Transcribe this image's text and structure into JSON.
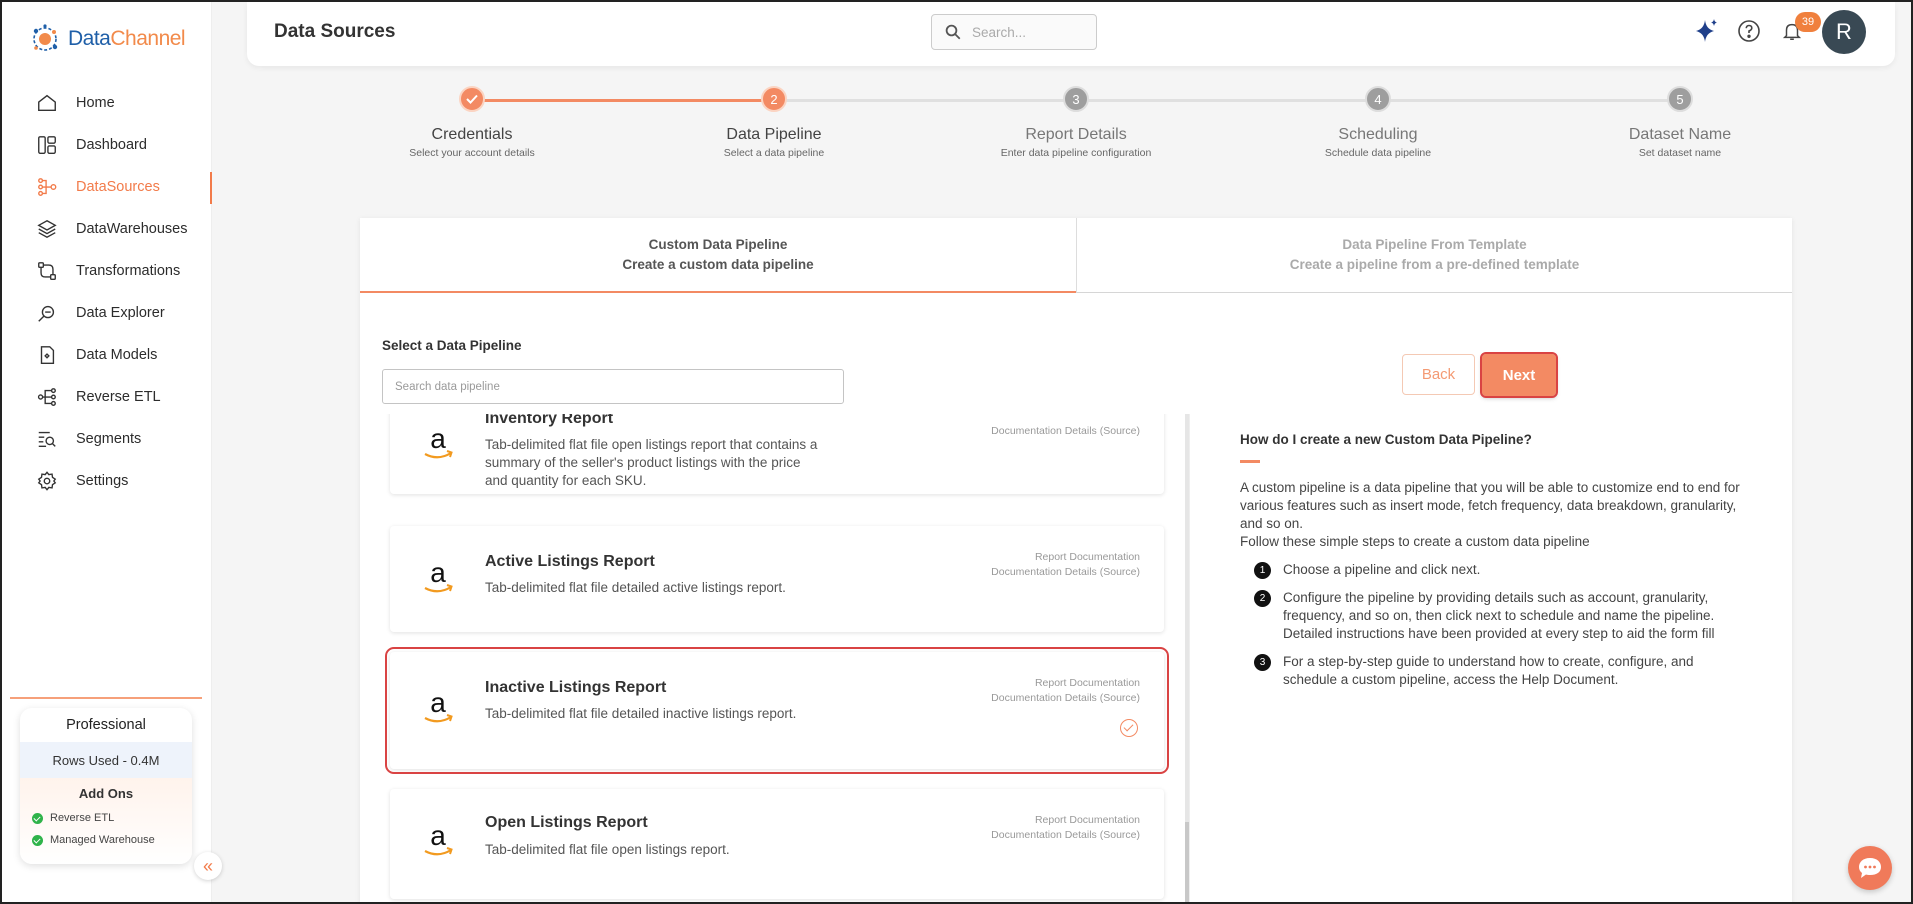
{
  "brand": {
    "name_part1": "Data",
    "name_part2": "Channel"
  },
  "sidebar": {
    "items": [
      {
        "label": "Home",
        "icon": "home-icon"
      },
      {
        "label": "Dashboard",
        "icon": "dashboard-icon"
      },
      {
        "label": "DataSources",
        "icon": "datasources-icon",
        "active": true
      },
      {
        "label": "DataWarehouses",
        "icon": "layers-icon"
      },
      {
        "label": "Transformations",
        "icon": "transform-icon"
      },
      {
        "label": "Data Explorer",
        "icon": "explorer-icon"
      },
      {
        "label": "Data Models",
        "icon": "model-icon"
      },
      {
        "label": "Reverse ETL",
        "icon": "reverse-etl-icon"
      },
      {
        "label": "Segments",
        "icon": "segments-icon"
      },
      {
        "label": "Settings",
        "icon": "gear-icon"
      }
    ],
    "plan": {
      "name": "Professional",
      "rows_used": "Rows Used - 0.4M",
      "addons_title": "Add Ons",
      "addons": [
        "Reverse ETL",
        "Managed Warehouse"
      ]
    }
  },
  "header": {
    "title": "Data Sources",
    "search_placeholder": "Search...",
    "notification_count": "39",
    "avatar_initial": "R"
  },
  "stepper": {
    "steps": [
      {
        "number": "",
        "name": "Credentials",
        "subtitle": "Select your account details",
        "state": "done"
      },
      {
        "number": "2",
        "name": "Data Pipeline",
        "subtitle": "Select a data pipeline",
        "state": "current"
      },
      {
        "number": "3",
        "name": "Report Details",
        "subtitle": "Enter data pipeline configuration",
        "state": "todo"
      },
      {
        "number": "4",
        "name": "Scheduling",
        "subtitle": "Schedule data pipeline",
        "state": "todo"
      },
      {
        "number": "5",
        "name": "Dataset Name",
        "subtitle": "Set dataset name",
        "state": "todo"
      }
    ]
  },
  "tabs": {
    "custom": {
      "title": "Custom Data Pipeline",
      "subtitle": "Create a custom data pipeline"
    },
    "template": {
      "title": "Data Pipeline From Template",
      "subtitle": "Create a pipeline from a pre-defined template"
    }
  },
  "pipeline": {
    "select_label": "Select a Data Pipeline",
    "search_placeholder": "Search data pipeline",
    "back_label": "Back",
    "next_label": "Next",
    "items": [
      {
        "title": "Inventory Report",
        "desc": "Tab-delimited flat file open listings report that contains a summary of the seller's product listings with the price and quantity for each SKU.",
        "link1": "",
        "link2": "Documentation Details (Source)"
      },
      {
        "title": "Active Listings Report",
        "desc": "Tab-delimited flat file detailed active listings report.",
        "link1": "Report Documentation",
        "link2": "Documentation Details (Source)"
      },
      {
        "title": "Inactive Listings Report",
        "desc": "Tab-delimited flat file detailed inactive listings report.",
        "link1": "Report Documentation",
        "link2": "Documentation Details (Source)",
        "selected": true
      },
      {
        "title": "Open Listings Report",
        "desc": "Tab-delimited flat file open listings report.",
        "link1": "Report Documentation",
        "link2": "Documentation Details (Source)"
      }
    ]
  },
  "help": {
    "title": "How do I create a new Custom Data Pipeline?",
    "intro": "A custom pipeline is a data pipeline that you will be able to customize end to end for various features such as insert mode, fetch frequency, data breakdown, granularity, and so on.",
    "intro2": "Follow these simple steps to create a custom data pipeline",
    "steps": [
      {
        "n": "1",
        "text": "Choose a pipeline and click next."
      },
      {
        "n": "2",
        "text": "Configure the pipeline by providing details such as account, granularity, frequency, and so on, then click next to schedule and name the pipeline. Detailed instructions have been provided at every step to aid the form fill"
      },
      {
        "n": "3",
        "text": "For a step-by-step guide to understand how to create, configure, and schedule a custom pipeline, access the Help Document."
      }
    ]
  },
  "colors": {
    "accent": "#f38a63",
    "brand_blue": "#1f5fa8",
    "highlight": "#d94343"
  }
}
